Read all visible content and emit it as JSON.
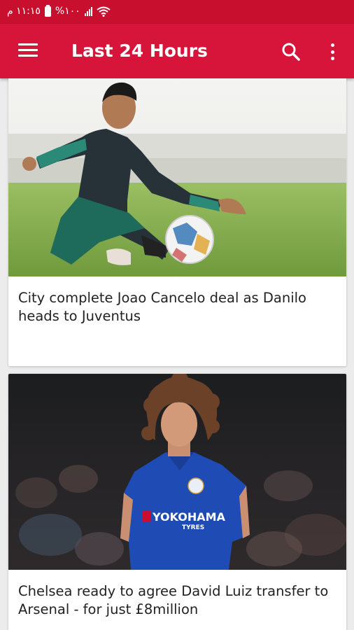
{
  "status_bar": {
    "time": "١١:١٥ م",
    "battery": "%١٠٠"
  },
  "app_bar": {
    "title": "Last 24 Hours"
  },
  "articles": [
    {
      "headline": "City complete Joao Cancelo deal as Danilo heads to Juventus",
      "image_subject": "footballer in dark training kit volleying a ball"
    },
    {
      "headline": "Chelsea ready to agree David Luiz transfer to Arsenal - for just £8million",
      "image_subject": "curly-haired footballer in blue Chelsea shirt",
      "shirt_sponsor": "YOKOHAMA",
      "shirt_sponsor_sub": "TYRES"
    }
  ],
  "colors": {
    "status_bar": "#c8102e",
    "app_bar": "#d7143a",
    "background": "#ececec"
  }
}
